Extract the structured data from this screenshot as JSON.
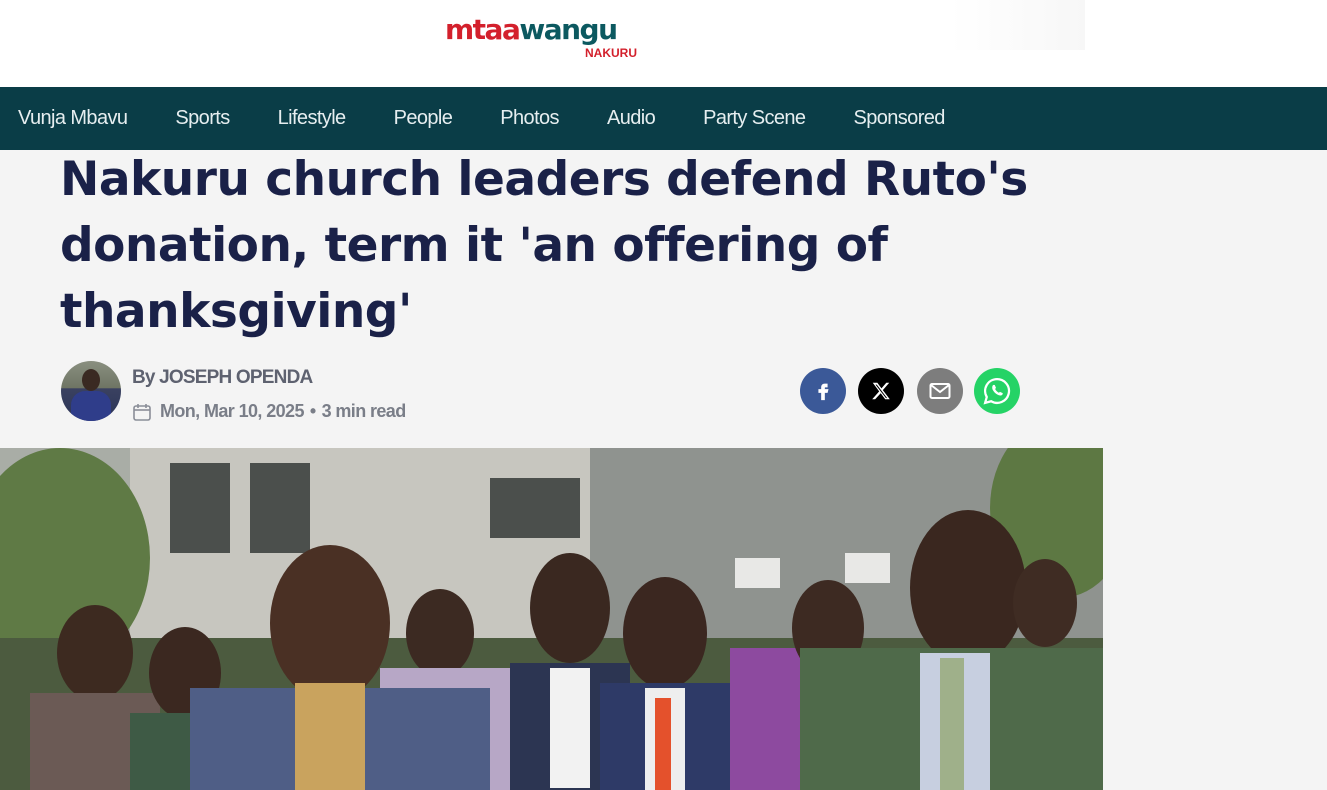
{
  "site": {
    "logo_part1": "mtaa",
    "logo_part2": "wangu",
    "logo_sub": "NAKURU",
    "brand_red": "#d3202c",
    "brand_teal": "#0c5960"
  },
  "nav": {
    "background": "#0a3d47",
    "items": [
      "Vunja Mbavu",
      "Sports",
      "Lifestyle",
      "People",
      "Photos",
      "Audio",
      "Party Scene",
      "Sponsored"
    ]
  },
  "article": {
    "headline": "Nakuru church leaders defend Ruto's donation, term it 'an offering of thanksgiving'",
    "byline": "By JOSEPH OPENDA",
    "date": "Mon, Mar 10, 2025",
    "separator": "•",
    "read_time": "3 min read"
  },
  "share": {
    "icons": [
      "facebook-icon",
      "x-icon",
      "email-icon",
      "whatsapp-icon"
    ]
  }
}
